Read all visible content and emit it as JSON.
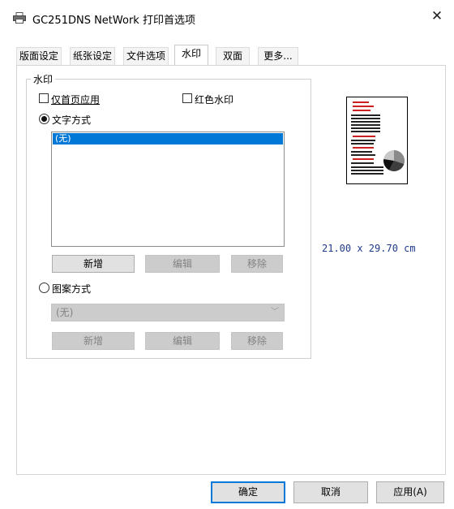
{
  "window": {
    "title": "GC251DNS NetWork 打印首选项",
    "close_glyph": "✕",
    "icon": "printer-icon"
  },
  "tabs": [
    {
      "label": "版面设定",
      "active": false
    },
    {
      "label": "纸张设定",
      "active": false
    },
    {
      "label": "文件选项",
      "active": false
    },
    {
      "label": "水印",
      "active": true
    },
    {
      "label": "双面",
      "active": false
    },
    {
      "label": "更多...",
      "active": false
    }
  ],
  "watermark": {
    "group_label": "水印",
    "first_page_only": {
      "label": "仅首页应用",
      "checked": false
    },
    "red_watermark": {
      "label": "红色水印",
      "checked": false
    },
    "text_mode": {
      "label": "文字方式",
      "selected": true,
      "list_items": [
        "(无)"
      ],
      "buttons": {
        "new": "新增",
        "edit": "编辑",
        "remove": "移除"
      }
    },
    "pattern_mode": {
      "label": "图案方式",
      "selected": false,
      "combo_value": "(无)",
      "buttons": {
        "new": "新增",
        "edit": "编辑",
        "remove": "移除"
      }
    }
  },
  "preview": {
    "paper_size": "21.00 x 29.70 cm",
    "accent_red": "#cc1f1f"
  },
  "footer": {
    "ok": "确定",
    "cancel": "取消",
    "apply": "应用(A)"
  }
}
